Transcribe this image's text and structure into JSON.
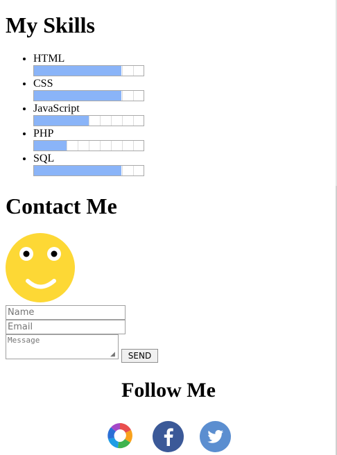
{
  "skills": {
    "heading": "My Skills",
    "items": [
      {
        "label": "HTML",
        "level": 0.8
      },
      {
        "label": "CSS",
        "level": 0.8
      },
      {
        "label": "JavaScript",
        "level": 0.5
      },
      {
        "label": "PHP",
        "level": 0.3
      },
      {
        "label": "SQL",
        "level": 0.8
      }
    ]
  },
  "contact": {
    "heading": "Contact Me",
    "name_placeholder": "Name",
    "email_placeholder": "Email",
    "message_placeholder": "Message",
    "send_label": "SEND"
  },
  "follow": {
    "heading": "Follow Me",
    "icons": [
      "sololearn-icon",
      "facebook-icon",
      "twitter-icon"
    ]
  },
  "colors": {
    "bar_fill": "#8ab4f8",
    "smiley": "#fdd835",
    "facebook": "#3b5998",
    "twitter": "#5b8ed0"
  }
}
